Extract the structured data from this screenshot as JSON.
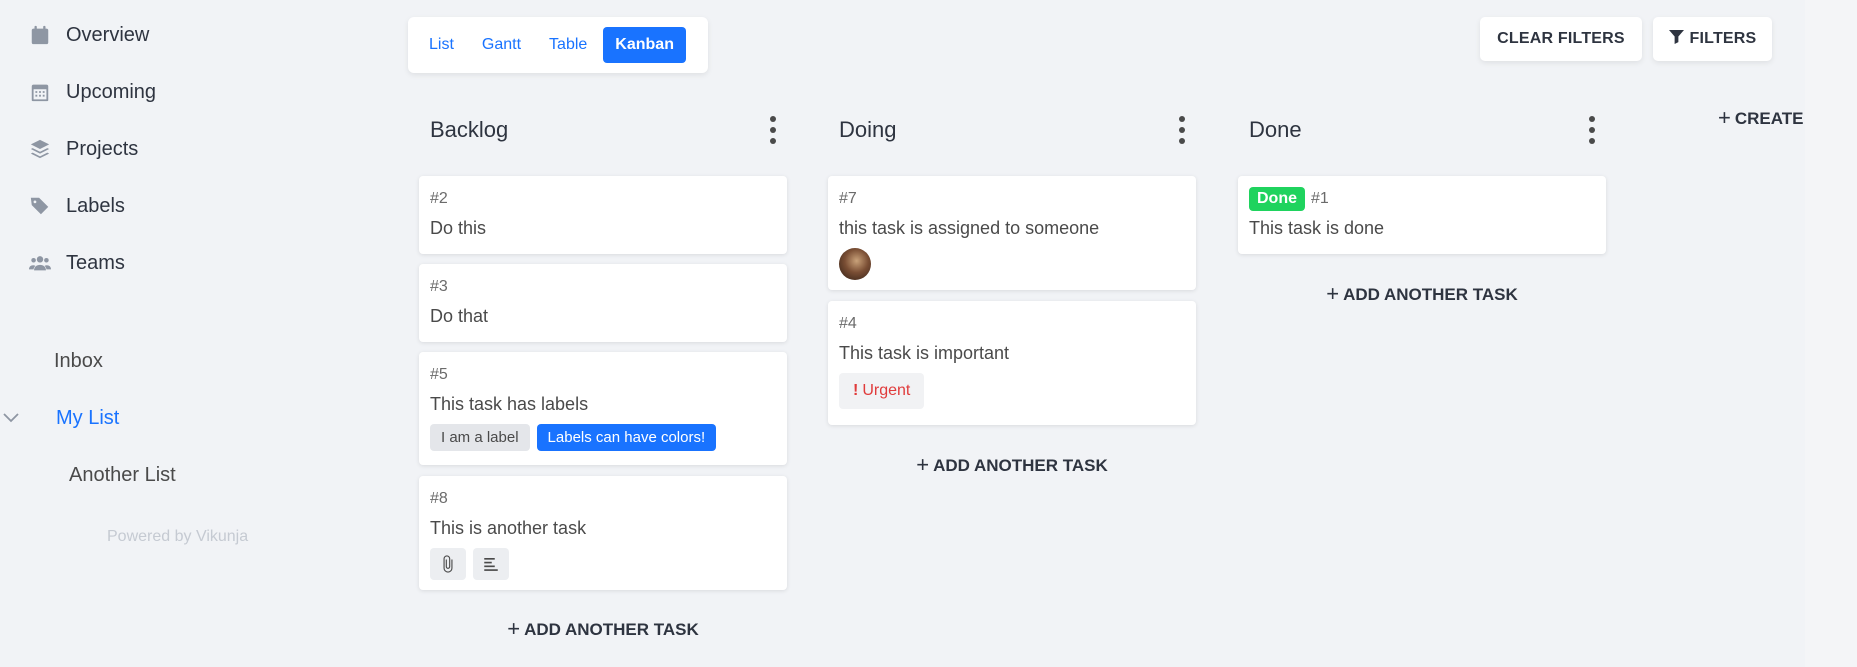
{
  "sidebar": {
    "nav": [
      {
        "label": "Overview",
        "icon": "calendar-icon"
      },
      {
        "label": "Upcoming",
        "icon": "calendar-grid-icon"
      },
      {
        "label": "Projects",
        "icon": "layers-icon"
      },
      {
        "label": "Labels",
        "icon": "tags-icon"
      },
      {
        "label": "Teams",
        "icon": "users-icon"
      }
    ],
    "lists": [
      "Inbox",
      "My List",
      "Another List"
    ],
    "powered_by": "Powered by Vikunja"
  },
  "views": {
    "list": "List",
    "gantt": "Gantt",
    "table": "Table",
    "kanban": "Kanban",
    "active": "Kanban"
  },
  "toolbar": {
    "clear_filters": "CLEAR FILTERS",
    "filters": "FILTERS"
  },
  "buckets": [
    {
      "title": "Backlog",
      "tasks": [
        {
          "id": "#2",
          "title": "Do this"
        },
        {
          "id": "#3",
          "title": "Do that"
        },
        {
          "id": "#5",
          "title": "This task has labels",
          "labels": [
            "I am a label",
            "Labels can have colors!"
          ]
        },
        {
          "id": "#8",
          "title": "This is another task",
          "icons": [
            "paperclip-icon",
            "description-icon"
          ]
        }
      ],
      "add_label": "ADD ANOTHER TASK"
    },
    {
      "title": "Doing",
      "tasks": [
        {
          "id": "#7",
          "title": "this task is assigned to someone",
          "assignee": "avatar"
        },
        {
          "id": "#4",
          "title": "This task is important",
          "priority": "Urgent"
        }
      ],
      "add_label": "ADD ANOTHER TASK"
    },
    {
      "title": "Done",
      "tasks": [
        {
          "id": "#1",
          "title": "This task is done",
          "badge": "Done"
        }
      ],
      "add_label": "ADD ANOTHER TASK"
    }
  ],
  "create_bucket": "CREATE",
  "colors": {
    "accent": "#1973ff",
    "done": "#1fd35e",
    "urgent": "#e03b3b",
    "background": "#f1f3f6"
  }
}
